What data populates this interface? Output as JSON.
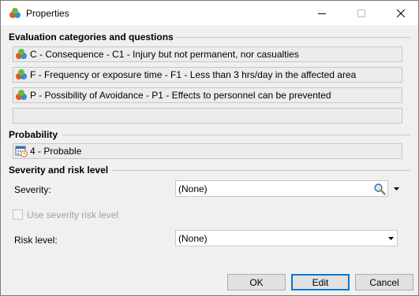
{
  "window": {
    "title": "Properties",
    "controls": {
      "minimize_icon": "minimize-icon",
      "maximize_icon": "maximize-icon",
      "close_icon": "close-icon"
    }
  },
  "evaluation": {
    "heading": "Evaluation categories and questions",
    "items": [
      {
        "icon": "category-icon",
        "text": "C - Consequence - C1 - Injury but not permanent, nor casualties"
      },
      {
        "icon": "category-icon",
        "text": "F - Frequency or exposure time - F1 - Less than 3 hrs/day in the affected area"
      },
      {
        "icon": "category-icon",
        "text": "P - Possibility of Avoidance - P1 - Effects to personnel can be prevented"
      },
      {
        "icon": "",
        "text": ""
      }
    ]
  },
  "probability": {
    "heading": "Probability",
    "value": "4 - Probable",
    "icon": "calendar-clock-icon"
  },
  "severity_risk": {
    "heading": "Severity and risk level",
    "severity_label": "Severity:",
    "severity_value": "(None)",
    "use_severity_label": "Use severity risk level",
    "use_severity_checked": false,
    "risk_label": "Risk level:",
    "risk_value": "(None)"
  },
  "buttons": {
    "ok": "OK",
    "edit": "Edit",
    "cancel": "Cancel"
  }
}
